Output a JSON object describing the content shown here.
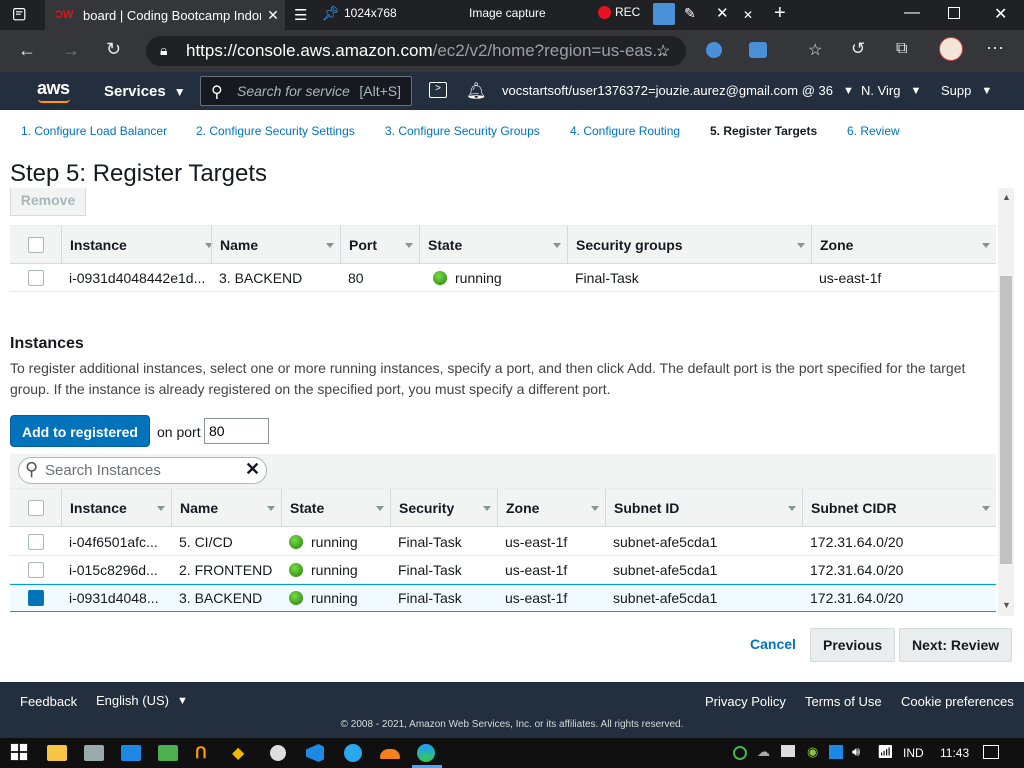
{
  "browser": {
    "tab_title": "board | Coding Bootcamp Indon",
    "tab_favicon": "dumbways-logo",
    "capture_size": "1024x768",
    "capture_label": "Image capture",
    "rec_label": "REC",
    "url_main": "https://console.aws.amazon.com",
    "url_rest": "/ec2/v2/home?region=us-eas..."
  },
  "aws_nav": {
    "logo": "aws",
    "services_label": "Services",
    "search_placeholder": "Search for service",
    "search_shortcut": "[Alt+S]",
    "account": "vocstartsoft/user1376372=jouzie.aurez@gmail.com @ 36",
    "region": "N. Virg",
    "support": "Supp"
  },
  "steps": [
    {
      "label": "1. Configure Load Balancer",
      "active": false
    },
    {
      "label": "2. Configure Security Settings",
      "active": false
    },
    {
      "label": "3. Configure Security Groups",
      "active": false
    },
    {
      "label": "4. Configure Routing",
      "active": false
    },
    {
      "label": "5. Register Targets",
      "active": true
    },
    {
      "label": "6. Review",
      "active": false
    }
  ],
  "page": {
    "title": "Step 5: Register Targets",
    "remove_label": "Remove"
  },
  "registered": {
    "headers": [
      "Instance",
      "Name",
      "Port",
      "State",
      "Security groups",
      "Zone"
    ],
    "rows": [
      {
        "instance": "i-0931d4048442e1d...",
        "name": "3. BACKEND",
        "port": "80",
        "state": "running",
        "sg": "Final-Task",
        "zone": "us-east-1f"
      }
    ]
  },
  "instances": {
    "heading": "Instances",
    "description": "To register additional instances, select one or more running instances, specify a port, and then click Add. The default port is the port specified for the target group. If the instance is already registered on the specified port, you must specify a different port.",
    "add_label": "Add to registered",
    "on_port_label": "on port",
    "port_value": "80",
    "search_placeholder": "Search Instances",
    "headers": [
      "Instance",
      "Name",
      "State",
      "Security",
      "Zone",
      "Subnet ID",
      "Subnet CIDR"
    ],
    "rows": [
      {
        "instance": "i-04f6501afc...",
        "name": "5. CI/CD",
        "state": "running",
        "security": "Final-Task",
        "zone": "us-east-1f",
        "subnet": "subnet-afe5cda1",
        "cidr": "172.31.64.0/20",
        "checked": false
      },
      {
        "instance": "i-015c8296d...",
        "name": "2. FRONTEND",
        "state": "running",
        "security": "Final-Task",
        "zone": "us-east-1f",
        "subnet": "subnet-afe5cda1",
        "cidr": "172.31.64.0/20",
        "checked": false
      },
      {
        "instance": "i-0931d4048...",
        "name": "3. BACKEND",
        "state": "running",
        "security": "Final-Task",
        "zone": "us-east-1f",
        "subnet": "subnet-afe5cda1",
        "cidr": "172.31.64.0/20",
        "checked": true
      }
    ]
  },
  "actions": {
    "cancel": "Cancel",
    "previous": "Previous",
    "next": "Next: Review"
  },
  "footer": {
    "feedback": "Feedback",
    "language": "English (US)",
    "privacy": "Privacy Policy",
    "terms": "Terms of Use",
    "cookies": "Cookie preferences",
    "copyright": "© 2008 - 2021, Amazon Web Services, Inc. or its affiliates. All rights reserved."
  },
  "taskbar": {
    "lang": "IND",
    "time": "11:43"
  },
  "colors": {
    "aws_nav": "#232f3e",
    "link": "#0073bb",
    "active_step": "#ec7211",
    "running": "#1d8102"
  }
}
